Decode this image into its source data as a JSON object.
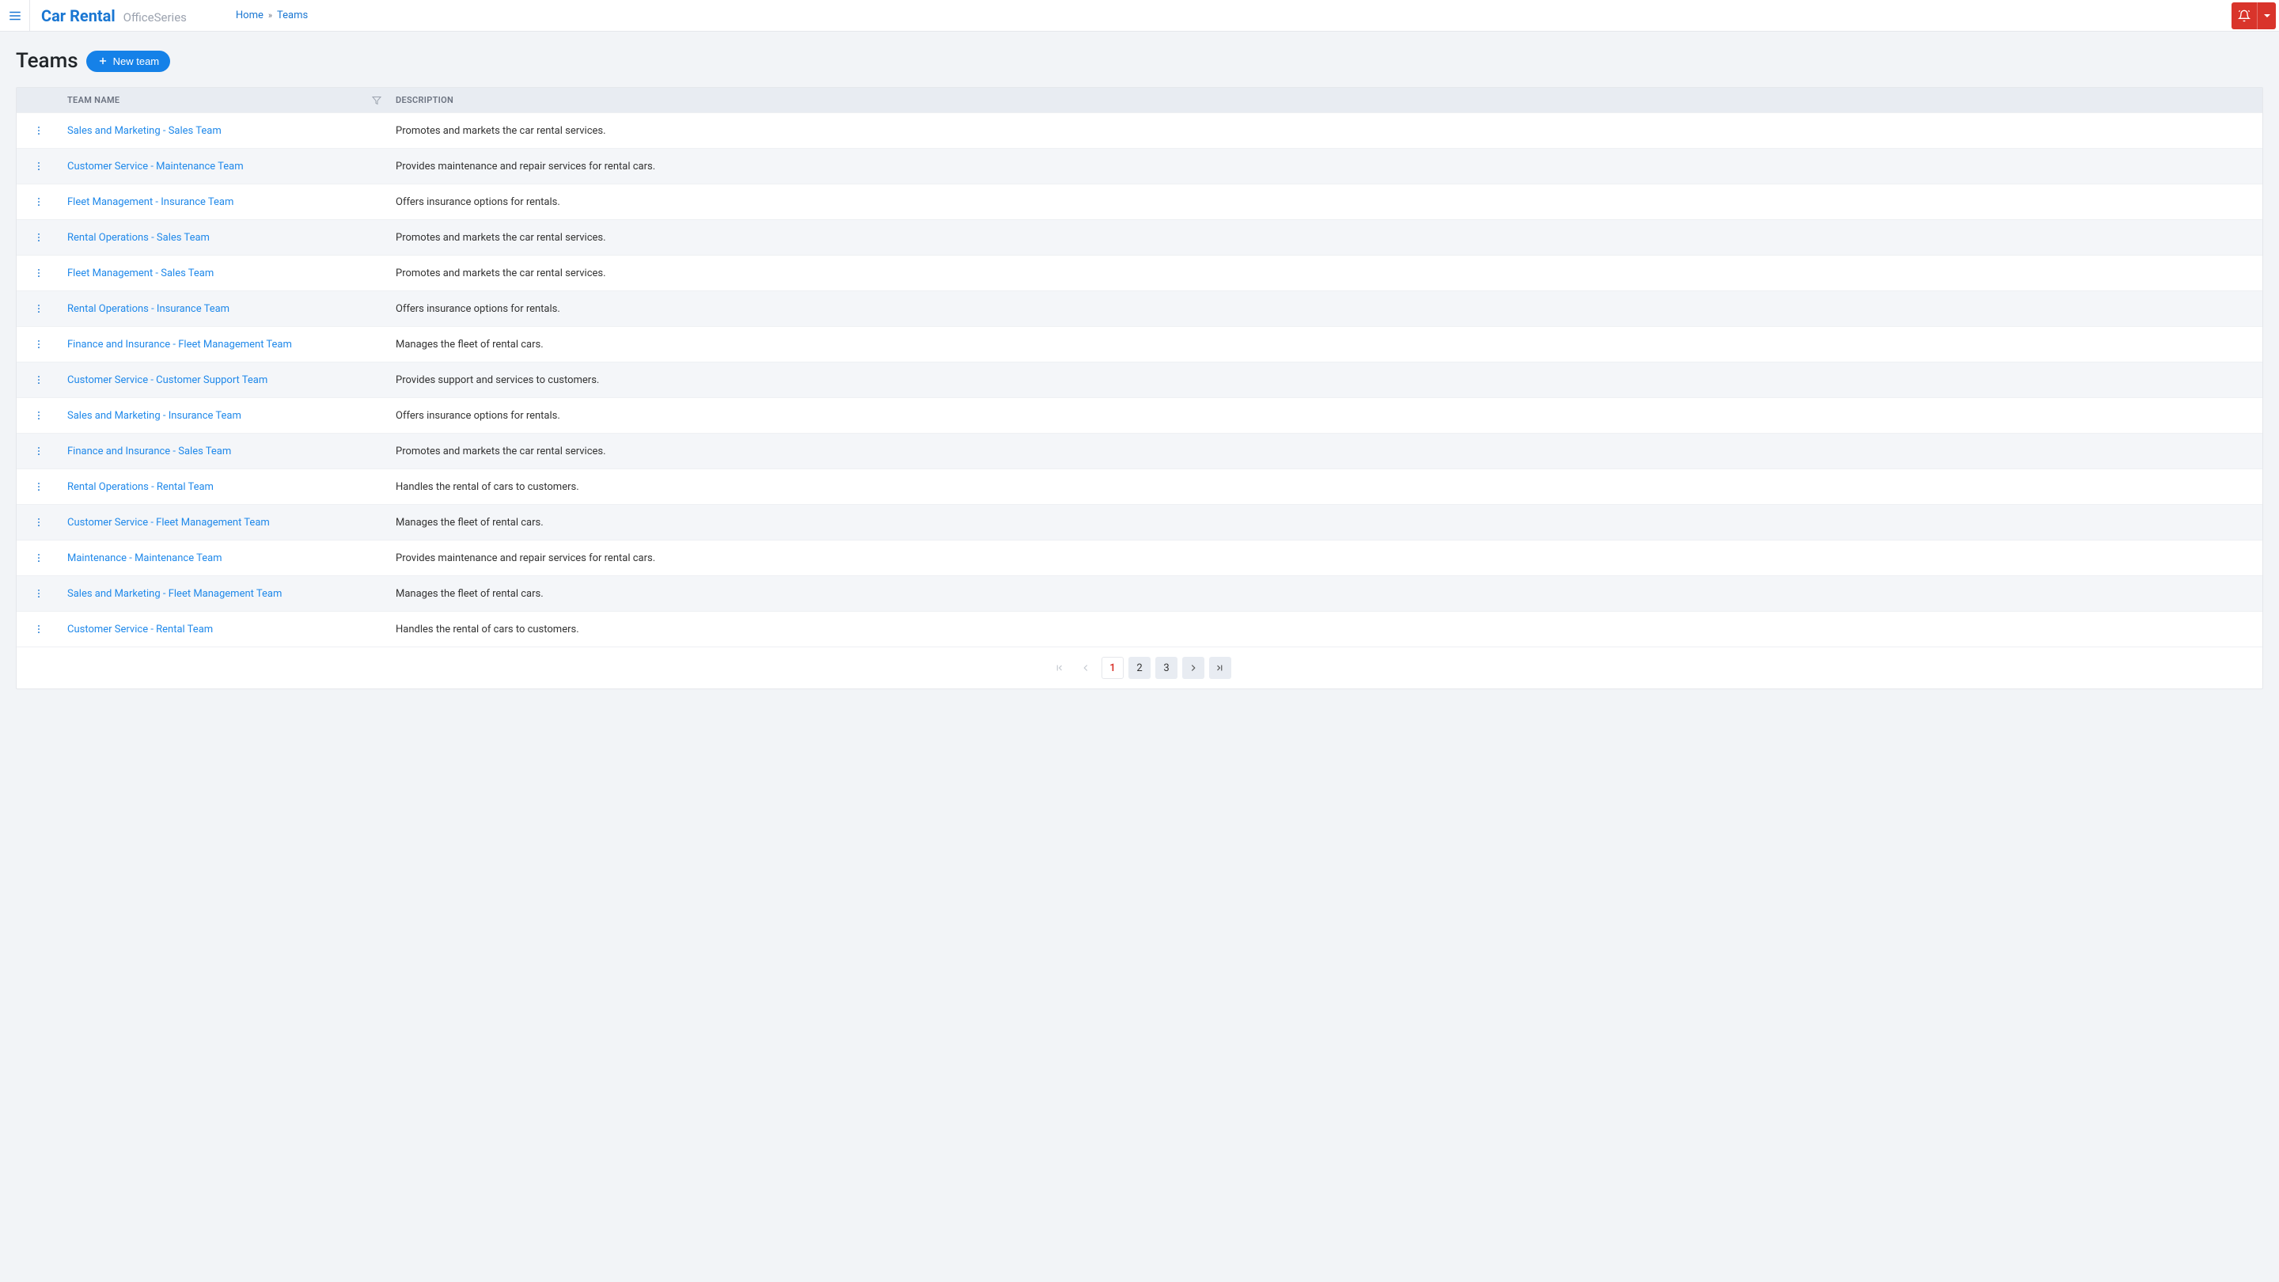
{
  "header": {
    "brand_title": "Car Rental",
    "brand_sub": "OfficeSeries",
    "breadcrumb": [
      {
        "label": "Home",
        "link": true
      },
      {
        "label": "Teams",
        "link": true
      }
    ]
  },
  "page": {
    "title": "Teams",
    "new_button_label": "New team"
  },
  "table": {
    "columns": {
      "name": "TEAM NAME",
      "description": "DESCRIPTION"
    },
    "rows": [
      {
        "name": "Sales and Marketing - Sales Team",
        "description": "Promotes and markets the car rental services."
      },
      {
        "name": "Customer Service - Maintenance Team",
        "description": "Provides maintenance and repair services for rental cars."
      },
      {
        "name": "Fleet Management - Insurance Team",
        "description": "Offers insurance options for rentals."
      },
      {
        "name": "Rental Operations - Sales Team",
        "description": "Promotes and markets the car rental services."
      },
      {
        "name": "Fleet Management - Sales Team",
        "description": "Promotes and markets the car rental services."
      },
      {
        "name": "Rental Operations - Insurance Team",
        "description": "Offers insurance options for rentals."
      },
      {
        "name": "Finance and Insurance - Fleet Management Team",
        "description": "Manages the fleet of rental cars."
      },
      {
        "name": "Customer Service - Customer Support Team",
        "description": "Provides support and services to customers."
      },
      {
        "name": "Sales and Marketing - Insurance Team",
        "description": "Offers insurance options for rentals."
      },
      {
        "name": "Finance and Insurance - Sales Team",
        "description": "Promotes and markets the car rental services."
      },
      {
        "name": "Rental Operations - Rental Team",
        "description": "Handles the rental of cars to customers."
      },
      {
        "name": "Customer Service - Fleet Management Team",
        "description": "Manages the fleet of rental cars."
      },
      {
        "name": "Maintenance - Maintenance Team",
        "description": "Provides maintenance and repair services for rental cars."
      },
      {
        "name": "Sales and Marketing - Fleet Management Team",
        "description": "Manages the fleet of rental cars."
      },
      {
        "name": "Customer Service - Rental Team",
        "description": "Handles the rental of cars to customers."
      }
    ]
  },
  "pagination": {
    "pages": [
      "1",
      "2",
      "3"
    ],
    "current": "1",
    "first_disabled": true,
    "prev_disabled": true,
    "next_disabled": false,
    "last_disabled": false
  }
}
